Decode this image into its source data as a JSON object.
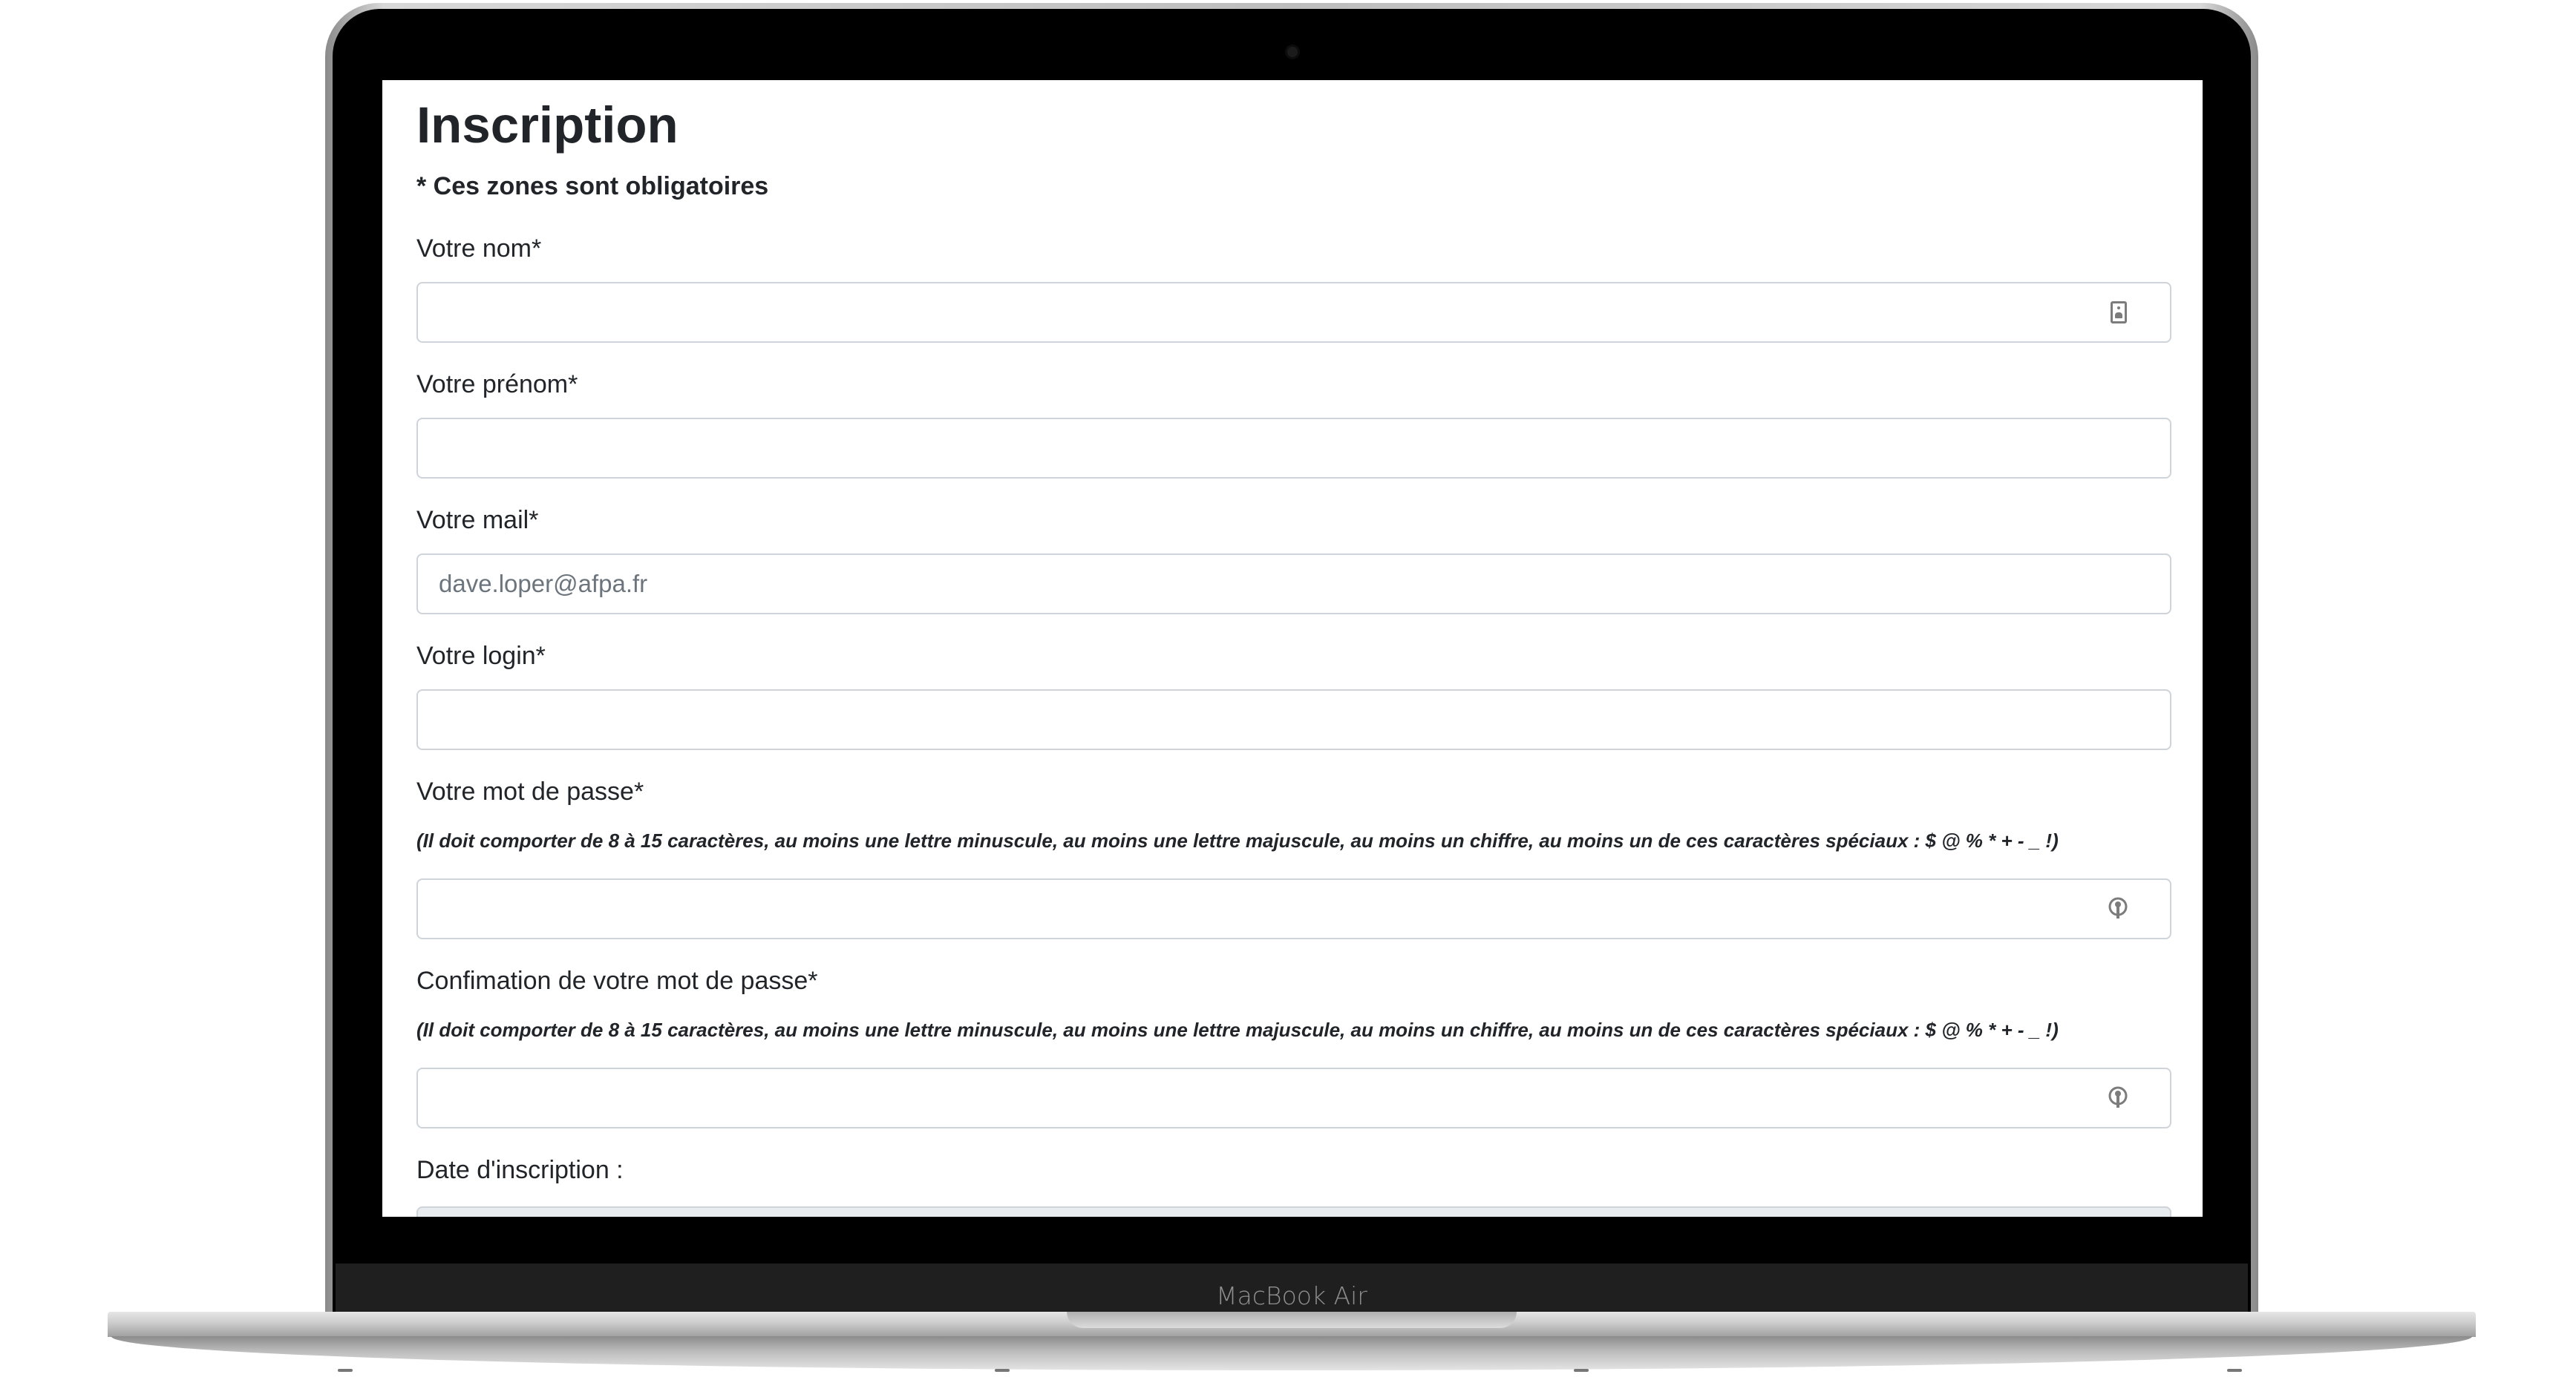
{
  "device": {
    "model_label": "MacBook Air"
  },
  "form": {
    "title": "Inscription",
    "required_note": "* Ces zones sont obligatoires",
    "fields": {
      "nom": {
        "label": "Votre nom*",
        "value": "",
        "placeholder": "",
        "icon": "contact-card-icon"
      },
      "prenom": {
        "label": "Votre prénom*",
        "value": "",
        "placeholder": ""
      },
      "mail": {
        "label": "Votre mail*",
        "value": "",
        "placeholder": "dave.loper@afpa.fr"
      },
      "login": {
        "label": "Votre login*",
        "value": "",
        "placeholder": ""
      },
      "password": {
        "label": "Votre mot de passe*",
        "hint": "(Il doit comporter de 8 à 15 caractères, au moins une lettre minuscule, au moins une lettre majuscule, au moins un chiffre, au moins un de ces caractères spéciaux : $ @ % * + - _ !)",
        "value": "",
        "placeholder": "",
        "icon": "password-key-icon"
      },
      "password_confirm": {
        "label": "Confimation de votre mot de passe*",
        "hint": "(Il doit comporter de 8 à 15 caractères, au moins une lettre minuscule, au moins une lettre majuscule, au moins un chiffre, au moins un de ces caractères spéciaux : $ @ % * + - _ !)",
        "value": "",
        "placeholder": "",
        "icon": "password-key-icon"
      },
      "date_inscription": {
        "label": "Date d'inscription :"
      }
    }
  }
}
